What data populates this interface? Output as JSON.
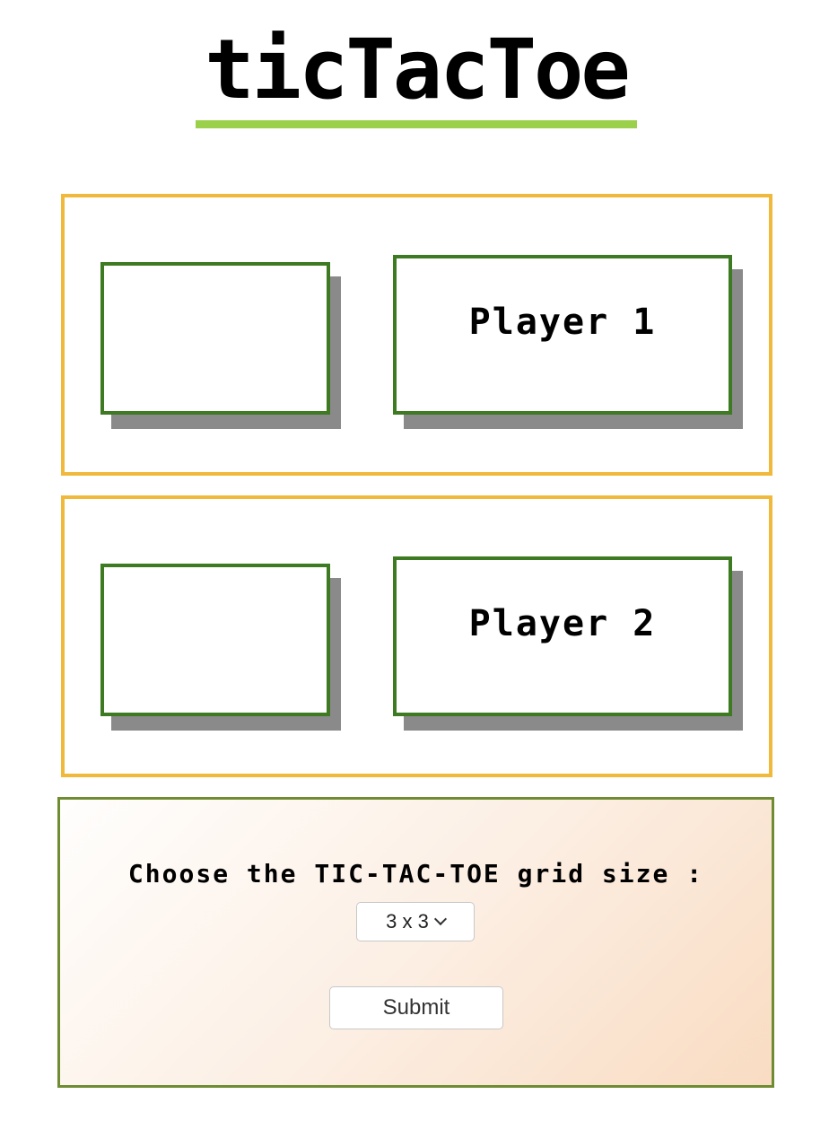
{
  "header": {
    "title": "ticTacToe",
    "underline_color": "#9bd14a"
  },
  "players": [
    {
      "name": "Player 1",
      "marker": ""
    },
    {
      "name": "Player 2",
      "marker": ""
    }
  ],
  "settings": {
    "prompt": "Choose the TIC-TAC-TOE grid size :",
    "grid_size": {
      "selected": "3 x 3"
    },
    "submit_label": "Submit"
  },
  "colors": {
    "panel_border": "#f1b93c",
    "box_border": "#3d7a22",
    "box_shadow": "#8a8a8a",
    "settings_border": "#6f8c33"
  }
}
